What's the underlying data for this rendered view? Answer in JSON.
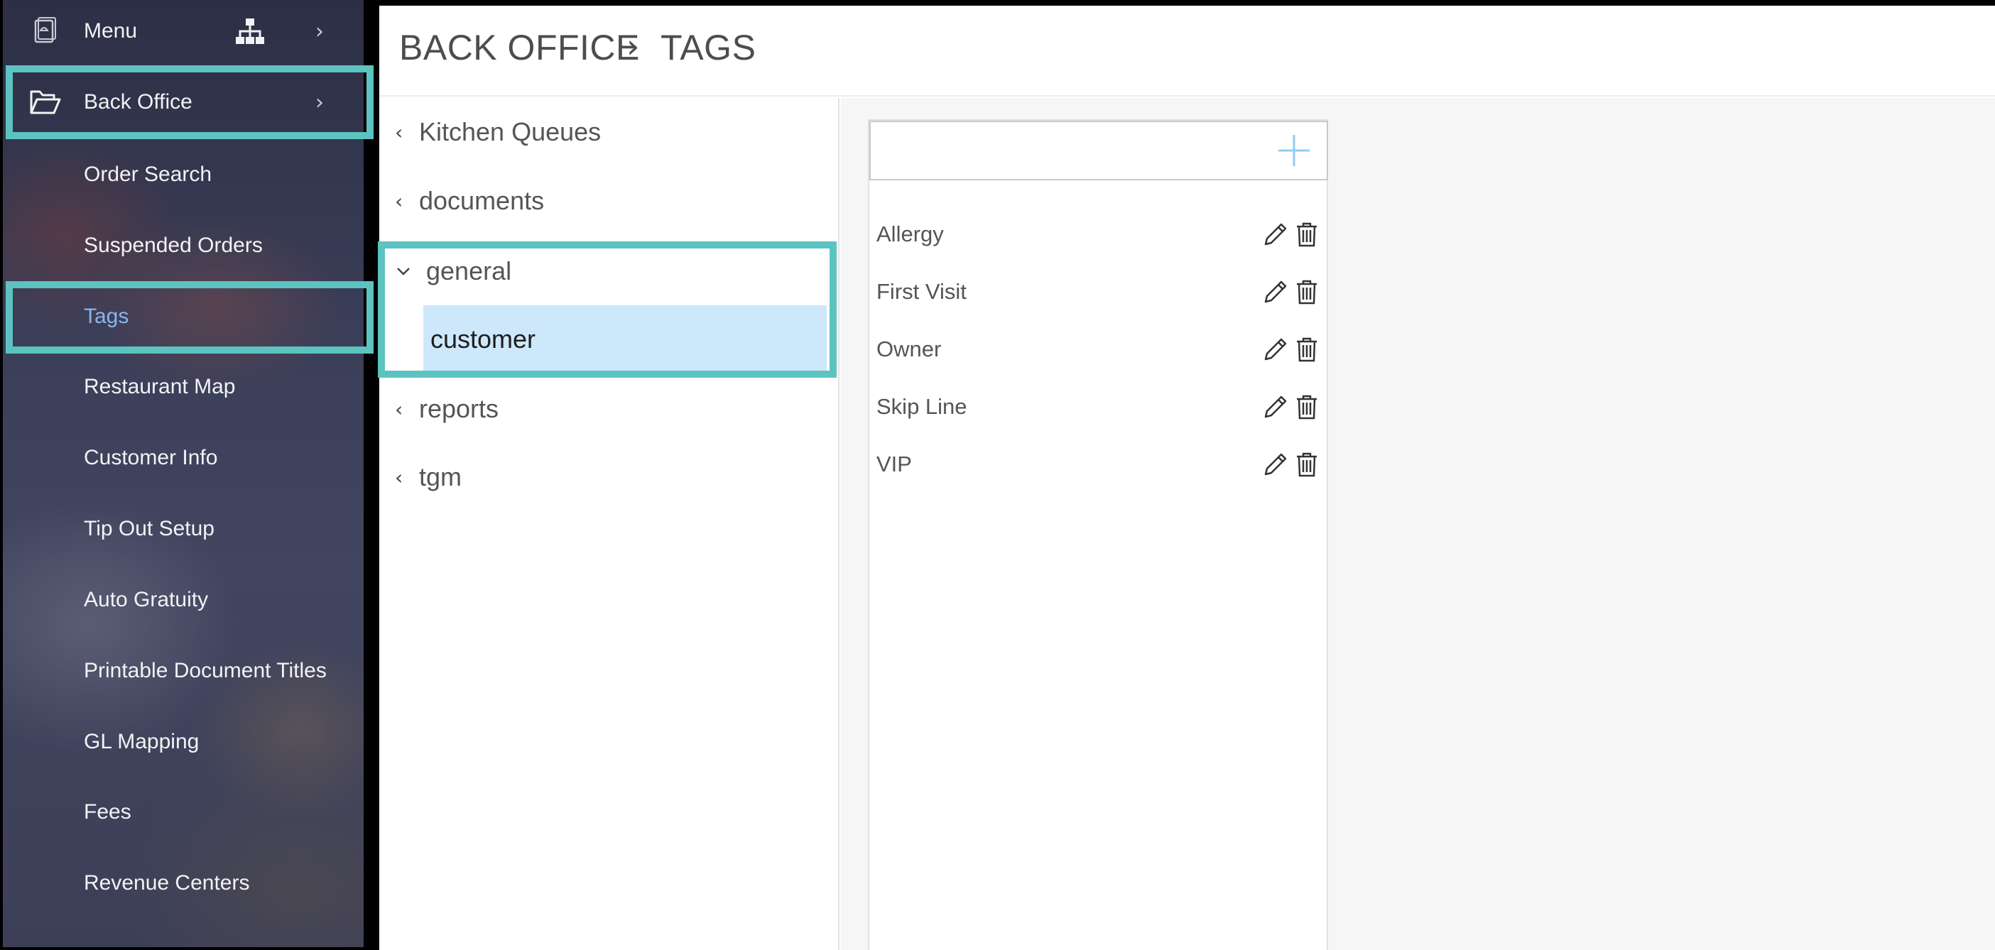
{
  "sidebar": {
    "menu_label": "Menu",
    "back_office_label": "Back Office",
    "items": [
      {
        "label": "Order Search"
      },
      {
        "label": "Suspended Orders"
      },
      {
        "label": "Tags"
      },
      {
        "label": "Restaurant Map"
      },
      {
        "label": "Customer Info"
      },
      {
        "label": "Tip Out Setup"
      },
      {
        "label": "Auto Gratuity"
      },
      {
        "label": "Printable Document Titles"
      },
      {
        "label": "GL Mapping"
      },
      {
        "label": "Fees"
      },
      {
        "label": "Revenue Centers"
      }
    ],
    "active_item": "Tags"
  },
  "header": {
    "crumb_root": "BACK OFFICE",
    "crumb_current": "TAGS"
  },
  "tree": {
    "items": [
      {
        "label": "Kitchen Queues"
      },
      {
        "label": "documents"
      },
      {
        "label": "general"
      },
      {
        "label": "reports"
      },
      {
        "label": "tgm"
      }
    ],
    "selected_child": "customer"
  },
  "tags": {
    "input_value": "",
    "items": [
      {
        "name": "Allergy"
      },
      {
        "name": "First Visit"
      },
      {
        "name": "Owner"
      },
      {
        "name": "Skip Line"
      },
      {
        "name": "VIP"
      }
    ]
  },
  "colors": {
    "highlight": "#5cc3c1",
    "active_link": "#86b6ef",
    "selected_row": "#cde8fb",
    "add_icon": "#8fcdf0"
  }
}
